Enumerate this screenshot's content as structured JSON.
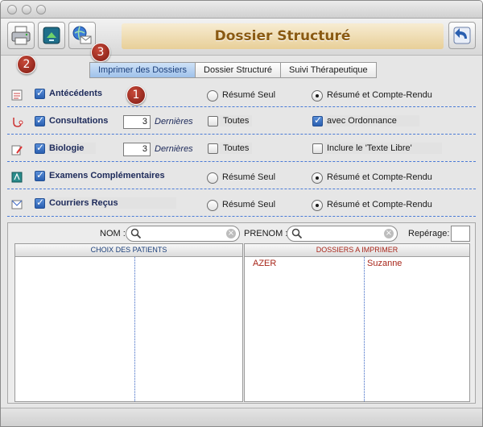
{
  "window": {
    "title": "Dossier Structuré"
  },
  "toolbar": {
    "buttons": [
      {
        "name": "print-icon"
      },
      {
        "name": "export-icon"
      },
      {
        "name": "globe-mail-icon"
      },
      {
        "name": "back-arrow-icon"
      }
    ]
  },
  "badges": [
    "1",
    "2",
    "3"
  ],
  "tabs": [
    {
      "label": "Imprimer des Dossiers",
      "active": true
    },
    {
      "label": "Dossier Structuré",
      "active": false
    },
    {
      "label": "Suivi Thérapeutique",
      "active": false
    }
  ],
  "rows": {
    "antecedents": {
      "label": "Antécédents",
      "checked": true,
      "opt1": "Résumé Seul",
      "opt2": "Résumé et Compte-Rendu",
      "selected": "opt2"
    },
    "consultations": {
      "label": "Consultations",
      "checked": true,
      "count": "3",
      "suffix": "Dernières",
      "toutes": "Toutes",
      "toutes_checked": false,
      "extra": "avec Ordonnance",
      "extra_checked": true
    },
    "biologie": {
      "label": "Biologie",
      "checked": true,
      "count": "3",
      "suffix": "Dernières",
      "toutes": "Toutes",
      "toutes_checked": false,
      "extra": "Inclure le 'Texte Libre'",
      "extra_checked": false
    },
    "examens": {
      "label": "Examens Complémentaires",
      "checked": true,
      "opt1": "Résumé Seul",
      "opt2": "Résumé et Compte-Rendu",
      "selected": "opt2"
    },
    "courriers": {
      "label": "Courriers Reçus",
      "checked": true,
      "opt1": "Résumé Seul",
      "opt2": "Résumé et Compte-Rendu",
      "selected": "opt2"
    }
  },
  "search": {
    "nom_label": "NOM :",
    "prenom_label": "PRENOM :",
    "reperage_label": "Repérage:",
    "nom_value": "",
    "prenom_value": "",
    "reperage_value": ""
  },
  "panels": {
    "patients_header": "CHOIX DES PATIENTS",
    "dossiers_header": "DOSSIERS A IMPRIMER",
    "dossiers": [
      {
        "nom": "AZER",
        "prenom": "Suzanne"
      }
    ]
  },
  "colors": {
    "accent": "#2a5fb0",
    "title": "#8a5a12",
    "dossier_text": "#a8261a",
    "badge": "#9b2a1f"
  }
}
